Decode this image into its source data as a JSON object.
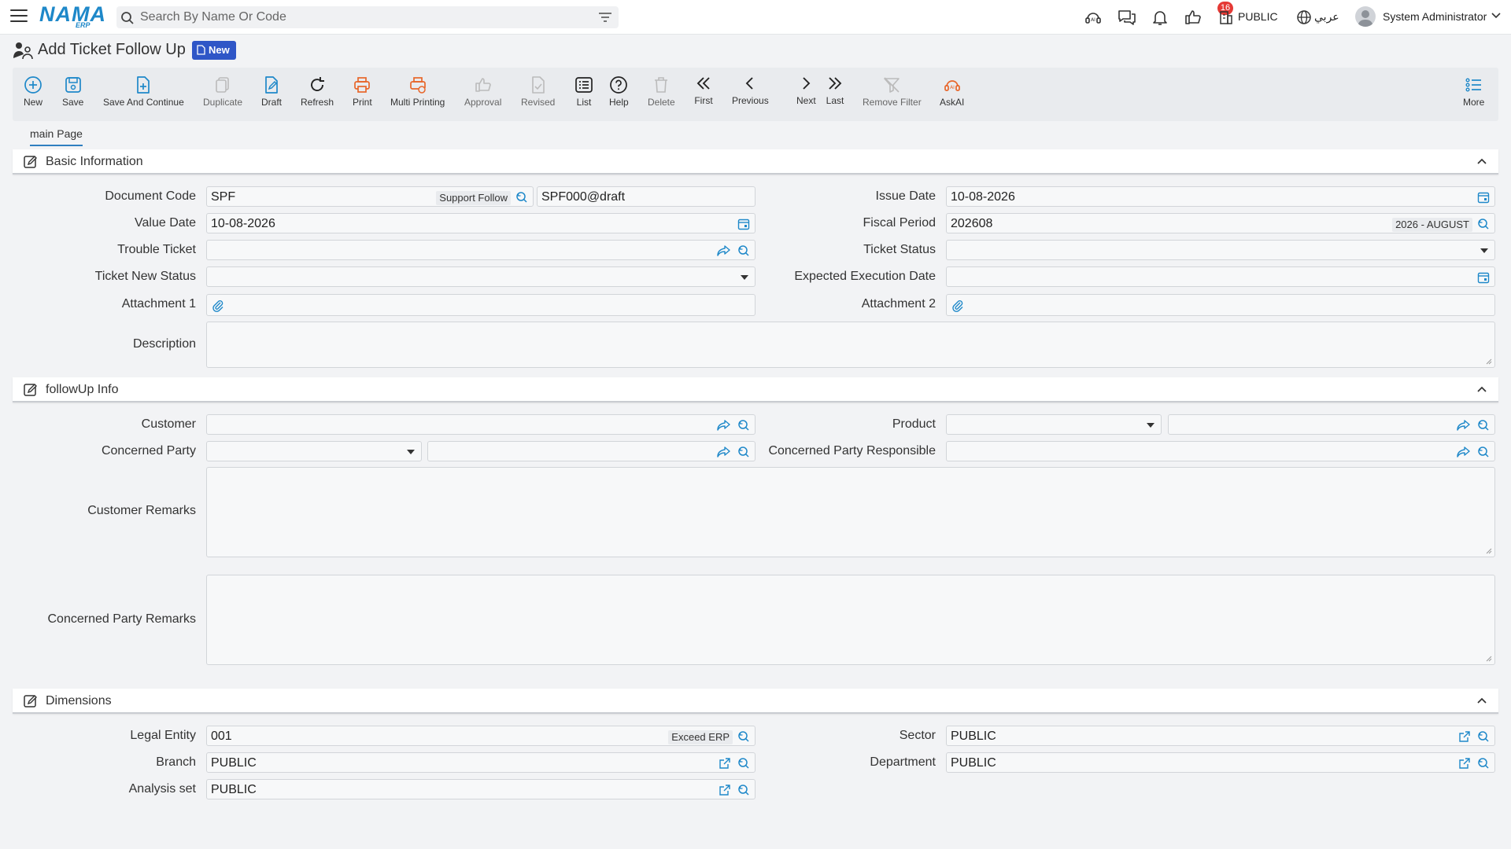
{
  "app": {
    "logo_main": "NAMA",
    "logo_sub": "ERP"
  },
  "search": {
    "placeholder": "Search By Name Or Code"
  },
  "topbar": {
    "notification_count": "16",
    "sector_label": "PUBLIC",
    "language_label": "عربي",
    "user_name": "System Administrator"
  },
  "page": {
    "title": "Add Ticket Follow Up",
    "status_badge": "New"
  },
  "toolbar": {
    "new": "New",
    "save": "Save",
    "save_continue": "Save And Continue",
    "duplicate": "Duplicate",
    "draft": "Draft",
    "refresh": "Refresh",
    "print": "Print",
    "multi_printing": "Multi Printing",
    "approval": "Approval",
    "revised": "Revised",
    "list": "List",
    "help": "Help",
    "delete": "Delete",
    "first": "First",
    "previous": "Previous",
    "next": "Next",
    "last": "Last",
    "remove_filter": "Remove Filter",
    "askai": "AskAI",
    "more": "More"
  },
  "tabs": {
    "main": "main Page"
  },
  "basic": {
    "header": "Basic Information",
    "document_code_label": "Document Code",
    "document_code": "SPF",
    "document_code_tag": "Support Follow",
    "document_number": "SPF000@draft",
    "issue_date_label": "Issue Date",
    "issue_date": "10-08-2026",
    "value_date_label": "Value Date",
    "value_date": "10-08-2026",
    "fiscal_period_label": "Fiscal Period",
    "fiscal_period": "202608",
    "fiscal_period_tag": "2026 - AUGUST",
    "trouble_ticket_label": "Trouble Ticket",
    "ticket_status_label": "Ticket Status",
    "ticket_new_status_label": "Ticket New Status",
    "expected_execution_label": "Expected Execution Date",
    "attachment1_label": "Attachment 1",
    "attachment2_label": "Attachment 2",
    "description_label": "Description"
  },
  "followup": {
    "header": "followUp Info",
    "customer_label": "Customer",
    "product_label": "Product",
    "concerned_party_label": "Concerned Party",
    "concerned_party_responsible_label": "Concerned Party Responsible",
    "customer_remarks_label": "Customer Remarks",
    "concerned_party_remarks_label": "Concerned Party Remarks"
  },
  "dimensions": {
    "header": "Dimensions",
    "legal_entity_label": "Legal Entity",
    "legal_entity": "001",
    "legal_entity_tag": "Exceed ERP",
    "sector_label": "Sector",
    "sector": "PUBLIC",
    "branch_label": "Branch",
    "branch": "PUBLIC",
    "department_label": "Department",
    "department": "PUBLIC",
    "analysis_set_label": "Analysis set",
    "analysis_set": "PUBLIC"
  },
  "colors": {
    "accent": "#1e88c9",
    "badge_blue": "#2f56c7",
    "print_orange": "#e8662a",
    "notification_red": "#e53935"
  }
}
